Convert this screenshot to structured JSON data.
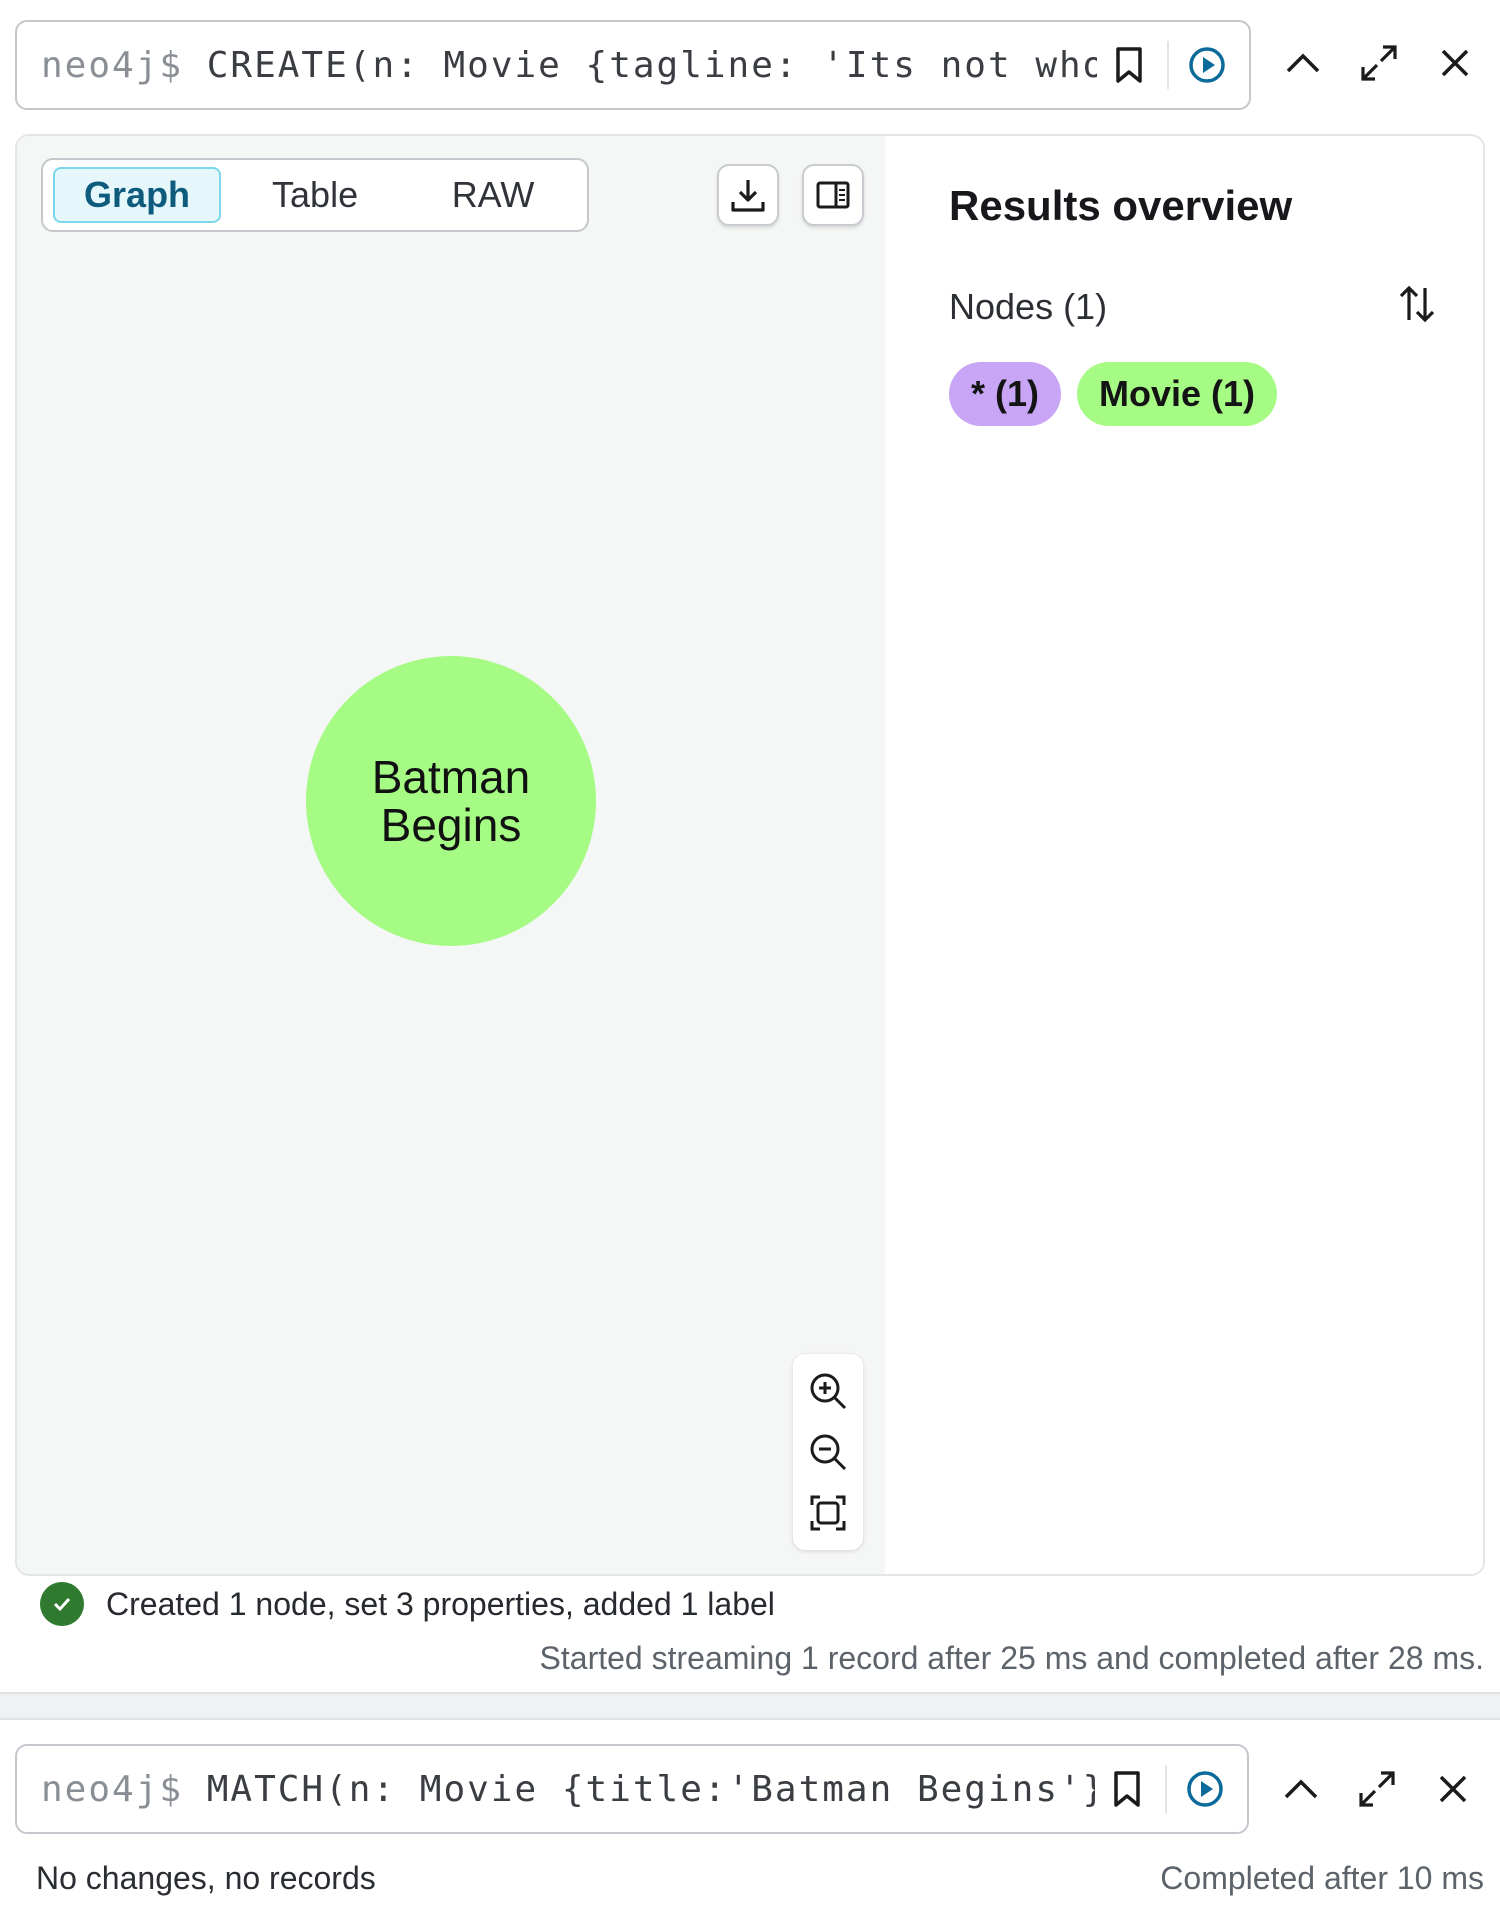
{
  "frame1": {
    "prompt": "neo4j$",
    "query": "CREATE(n: Movie {tagline: 'Its not who y",
    "tabs": [
      {
        "label": "Graph",
        "active": true
      },
      {
        "label": "Table",
        "active": false
      },
      {
        "label": "RAW",
        "active": false
      }
    ],
    "node": {
      "caption": "Batman Begins",
      "color": "#a6fb85"
    },
    "overview": {
      "title": "Results overview",
      "nodes_label": "Nodes (1)",
      "chips": [
        {
          "label": "* (1)",
          "color": "#c9a5f5"
        },
        {
          "label": "Movie (1)",
          "color": "#a6fb85"
        }
      ]
    },
    "status": "Created 1 node, set 3 properties, added 1 label",
    "timing": "Started streaming 1 record after 25 ms and completed after 28 ms."
  },
  "frame2": {
    "prompt": "neo4j$",
    "query": "MATCH(n: Movie {title:'Batman Begins'})",
    "status": "No changes, no records",
    "timing": "Completed after 10 ms"
  },
  "colors": {
    "accent": "#0a6b9a",
    "success": "#2f7a2f"
  }
}
